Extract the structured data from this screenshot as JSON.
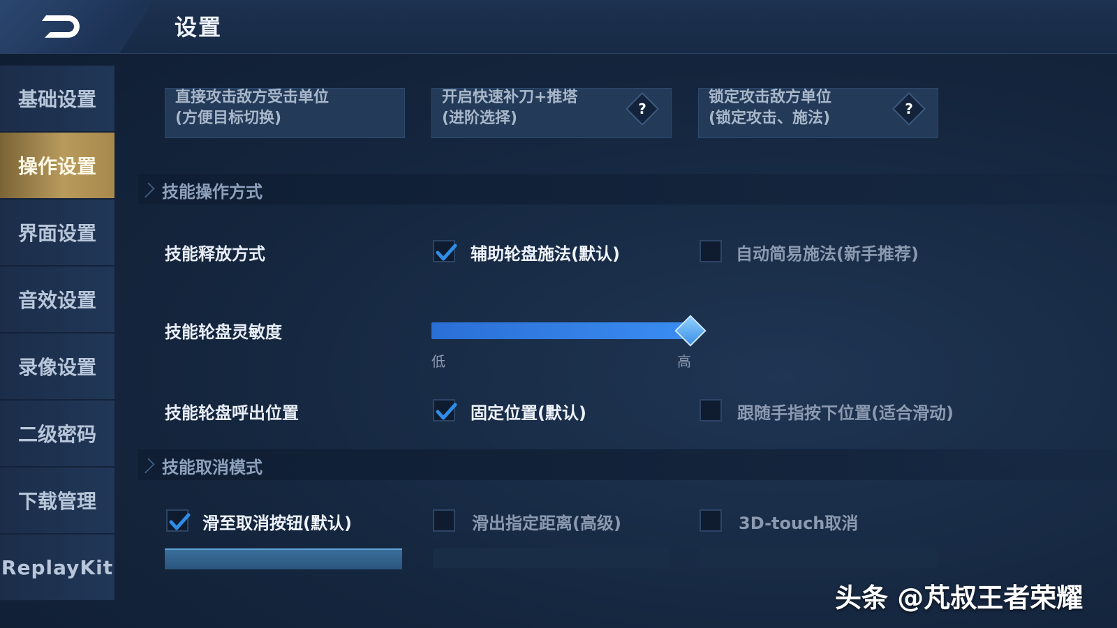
{
  "header": {
    "title": "设置"
  },
  "sidebar": {
    "items": [
      {
        "label": "基础设置"
      },
      {
        "label": "操作设置"
      },
      {
        "label": "界面设置"
      },
      {
        "label": "音效设置"
      },
      {
        "label": "录像设置"
      },
      {
        "label": "二级密码"
      },
      {
        "label": "下载管理"
      },
      {
        "label": "ReplayKit"
      }
    ],
    "active_index": 1
  },
  "target_cards": [
    {
      "line1": "直接攻击敌方受击单位",
      "line2": "(方便目标切换)",
      "has_help": false
    },
    {
      "line1": "开启快速补刀+推塔",
      "line2": "(进阶选择)",
      "has_help": true,
      "help": "?"
    },
    {
      "line1": "锁定攻击敌方单位",
      "line2": "(锁定攻击、施法)",
      "has_help": true,
      "help": "?"
    }
  ],
  "skill_operation": {
    "section_title": "技能操作方式",
    "release_mode": {
      "label": "技能释放方式",
      "options": [
        {
          "label": "辅助轮盘施法(默认)",
          "checked": true
        },
        {
          "label": "自动简易施法(新手推荐)",
          "checked": false
        }
      ]
    },
    "sensitivity": {
      "label": "技能轮盘灵敏度",
      "low_label": "低",
      "high_label": "高",
      "value_fraction": 1.0
    },
    "wheel_position": {
      "label": "技能轮盘呼出位置",
      "options": [
        {
          "label": "固定位置(默认)",
          "checked": true
        },
        {
          "label": "跟随手指按下位置(适合滑动)",
          "checked": false
        }
      ]
    }
  },
  "skill_cancel": {
    "section_title": "技能取消模式",
    "options": [
      {
        "label": "滑至取消按钮(默认)",
        "checked": true
      },
      {
        "label": "滑出指定距离(高级)",
        "checked": false
      },
      {
        "label": "3D-touch取消",
        "checked": false
      }
    ]
  },
  "watermark": "头条 @芃叔王者荣耀",
  "colors": {
    "accent_blue": "#3a8cf2",
    "active_tab_gold": "#b89a5c",
    "check_blue": "#2f8de8",
    "background": "#14253d"
  }
}
